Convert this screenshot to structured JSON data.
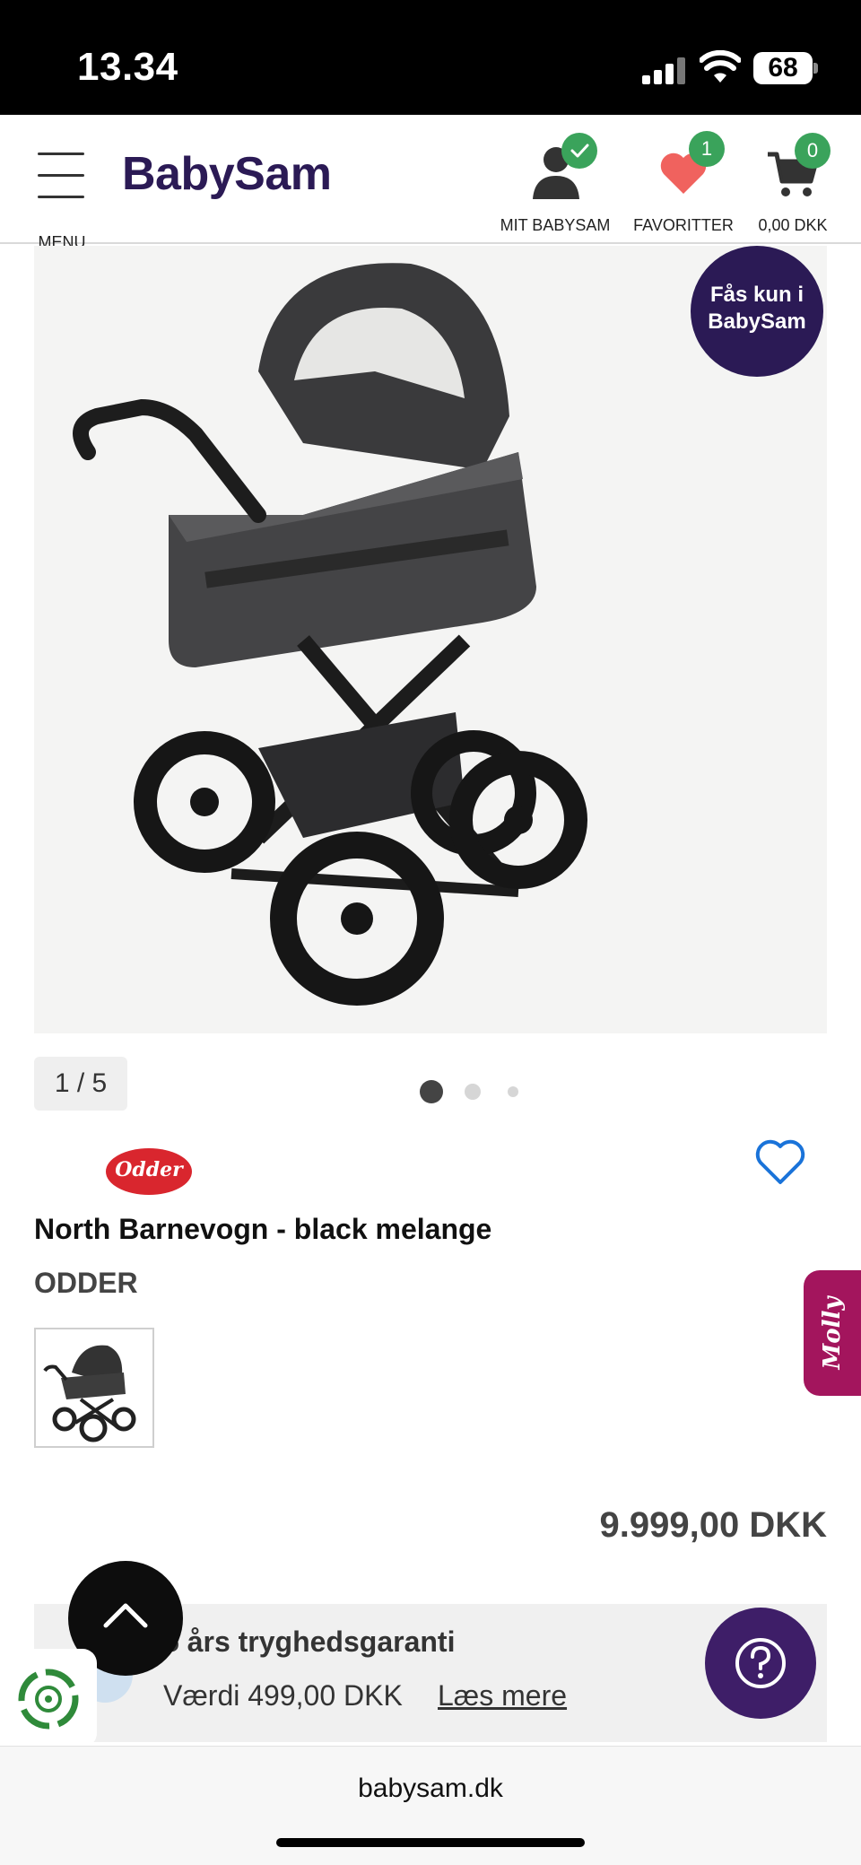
{
  "status_bar": {
    "time": "13.34",
    "battery": "68"
  },
  "header": {
    "menu_label": "MENU",
    "logo": "BabySam",
    "account_label": "MIT BABYSAM",
    "favorites_label": "FAVORITTER",
    "favorites_count": "1",
    "cart_label": "0,00 DKK",
    "cart_count": "0"
  },
  "gallery": {
    "badge_line1": "Fås kun i",
    "badge_line2": "BabySam",
    "counter": "1 / 5"
  },
  "product": {
    "brand_logo_text": "Odder",
    "title": "North Barnevogn - black melange",
    "brand": "ODDER",
    "price": "9.999,00 DKK"
  },
  "guarantee": {
    "title": "5 års tryghedsgaranti",
    "value": "Værdi 499,00 DKK",
    "link": "Læs mere"
  },
  "chat_tab": {
    "label": "Molly"
  },
  "browser": {
    "url": "babysam.dk"
  },
  "colors": {
    "brand_purple": "#2b1a55",
    "badge_green": "#3aa35b",
    "heart_red": "#f0625e",
    "molly_magenta": "#a3155d"
  }
}
